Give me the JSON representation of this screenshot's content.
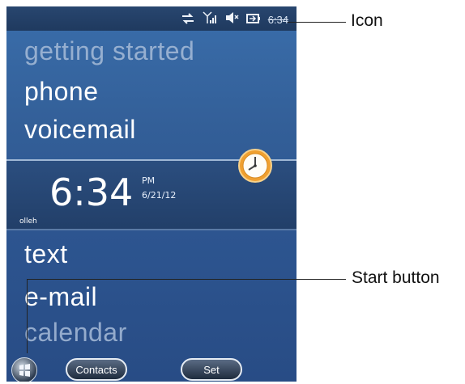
{
  "status": {
    "time": "6:34",
    "icons": [
      "sync-icon",
      "signal-icon",
      "volume-muted-icon",
      "battery-icon"
    ]
  },
  "menu": {
    "items": [
      {
        "label": "getting started"
      },
      {
        "label": "phone"
      },
      {
        "label": "voicemail"
      },
      {
        "label": "text"
      },
      {
        "label": "e-mail"
      },
      {
        "label": "calendar"
      }
    ]
  },
  "clock": {
    "time": "6:34",
    "ampm": "PM",
    "date": "6/21/12",
    "carrier": "olleh"
  },
  "taskbar": {
    "contacts_label": "Contacts",
    "set_label": "Set"
  },
  "callouts": {
    "icon_label": "Icon",
    "start_label": "Start button"
  },
  "colors": {
    "background": "#335f98",
    "clock_accent": "#f0a030"
  }
}
